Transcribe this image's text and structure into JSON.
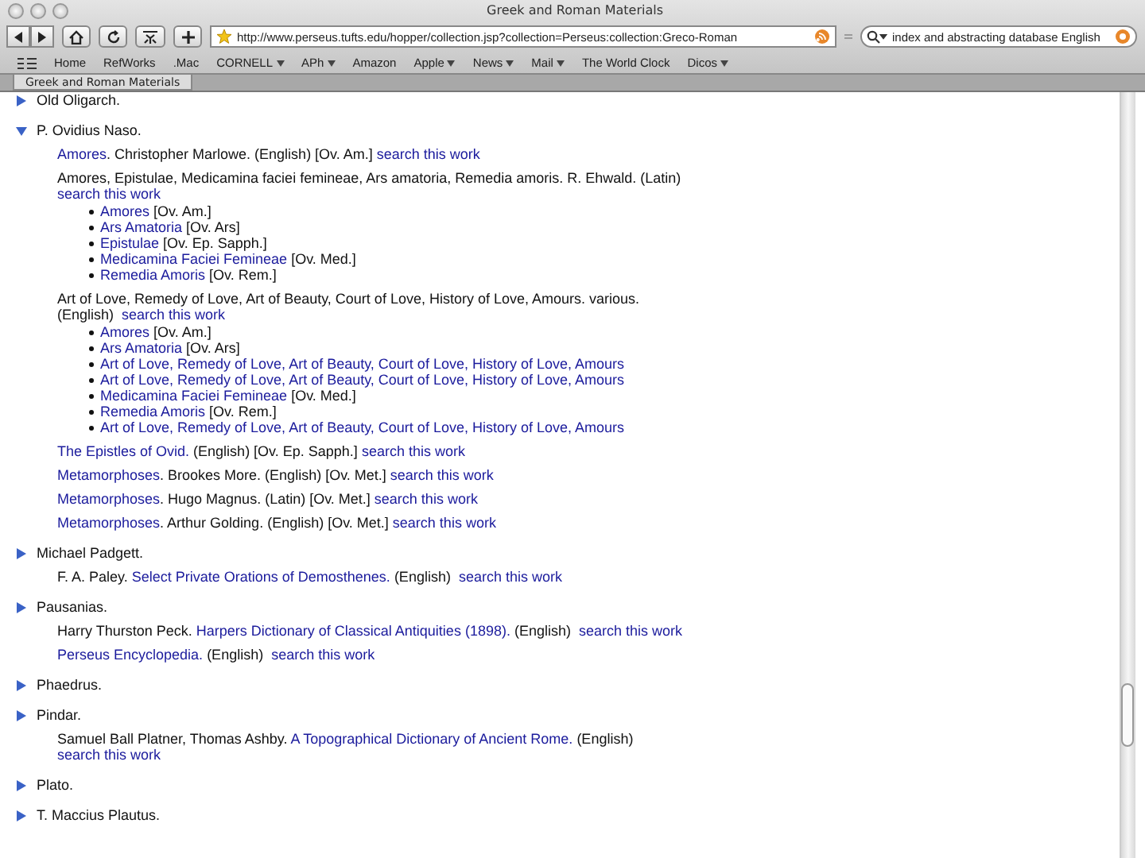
{
  "window": {
    "title": "Greek and Roman Materials"
  },
  "toolbar": {
    "address": "http://www.perseus.tufts.edu/hopper/collection.jsp?collection=Perseus:collection:Greco-Roman",
    "search": "index and abstracting database English"
  },
  "bookmarks": [
    {
      "label": "Home",
      "menu": false
    },
    {
      "label": "RefWorks",
      "menu": false
    },
    {
      "label": ".Mac",
      "menu": false
    },
    {
      "label": "CORNELL",
      "menu": true
    },
    {
      "label": "APh",
      "menu": true
    },
    {
      "label": "Amazon",
      "menu": false
    },
    {
      "label": "Apple",
      "menu": true
    },
    {
      "label": "News",
      "menu": true
    },
    {
      "label": "Mail",
      "menu": true
    },
    {
      "label": "The World Clock",
      "menu": false
    },
    {
      "label": "Dicos",
      "menu": true
    }
  ],
  "tabs": [
    {
      "label": "Greek and Roman Materials",
      "selected": true
    }
  ],
  "authors": [
    {
      "name": "Old Oligarch.",
      "expanded": false
    },
    {
      "name": "P. Ovidius Naso.",
      "expanded": true,
      "works": [
        {
          "segments": [
            {
              "text": "Amores",
              "link": true
            },
            {
              "text": ". Christopher Marlowe. (English) [Ov. Am.] ",
              "link": false
            },
            {
              "text": "search this work",
              "link": true
            }
          ]
        },
        {
          "segments": [
            {
              "text": "Amores, Epistulae, Medicamina faciei femineae, Ars amatoria, Remedia amoris. R. Ehwald. (Latin)  ",
              "link": false
            },
            {
              "text": "search this work",
              "link": true
            }
          ],
          "items": [
            {
              "segments": [
                {
                  "text": "Amores",
                  "link": true
                },
                {
                  "text": " [Ov. Am.]",
                  "link": false
                }
              ]
            },
            {
              "segments": [
                {
                  "text": "Ars Amatoria",
                  "link": true
                },
                {
                  "text": " [Ov. Ars]",
                  "link": false
                }
              ]
            },
            {
              "segments": [
                {
                  "text": "Epistulae",
                  "link": true
                },
                {
                  "text": " [Ov. Ep. Sapph.]",
                  "link": false
                }
              ]
            },
            {
              "segments": [
                {
                  "text": "Medicamina Faciei Femineae",
                  "link": true
                },
                {
                  "text": " [Ov. Med.]",
                  "link": false
                }
              ]
            },
            {
              "segments": [
                {
                  "text": "Remedia Amoris",
                  "link": true
                },
                {
                  "text": " [Ov. Rem.]",
                  "link": false
                }
              ]
            }
          ]
        },
        {
          "segments": [
            {
              "text": "Art of Love, Remedy of Love, Art of Beauty, Court of Love, History of Love, Amours. various. (English)  ",
              "link": false
            },
            {
              "text": "search this work",
              "link": true
            }
          ],
          "items": [
            {
              "segments": [
                {
                  "text": "Amores",
                  "link": true
                },
                {
                  "text": " [Ov. Am.]",
                  "link": false
                }
              ]
            },
            {
              "segments": [
                {
                  "text": "Ars Amatoria",
                  "link": true
                },
                {
                  "text": " [Ov. Ars]",
                  "link": false
                }
              ]
            },
            {
              "segments": [
                {
                  "text": "Art of Love, Remedy of Love, Art of Beauty, Court of Love, History of Love, Amours",
                  "link": true
                }
              ]
            },
            {
              "segments": [
                {
                  "text": "Art of Love, Remedy of Love, Art of Beauty, Court of Love, History of Love, Amours",
                  "link": true
                }
              ]
            },
            {
              "segments": [
                {
                  "text": "Medicamina Faciei Femineae",
                  "link": true
                },
                {
                  "text": " [Ov. Med.]",
                  "link": false
                }
              ]
            },
            {
              "segments": [
                {
                  "text": "Remedia Amoris",
                  "link": true
                },
                {
                  "text": " [Ov. Rem.]",
                  "link": false
                }
              ]
            },
            {
              "segments": [
                {
                  "text": "Art of Love, Remedy of Love, Art of Beauty, Court of Love, History of Love, Amours",
                  "link": true
                }
              ]
            }
          ]
        },
        {
          "segments": [
            {
              "text": "The Epistles of Ovid.",
              "link": true
            },
            {
              "text": " (English) [Ov. Ep. Sapph.] ",
              "link": false
            },
            {
              "text": "search this work",
              "link": true
            }
          ]
        },
        {
          "segments": [
            {
              "text": "Metamorphoses",
              "link": true
            },
            {
              "text": ". Brookes More. (English) [Ov. Met.] ",
              "link": false
            },
            {
              "text": "search this work",
              "link": true
            }
          ]
        },
        {
          "segments": [
            {
              "text": "Metamorphoses",
              "link": true
            },
            {
              "text": ". Hugo Magnus. (Latin) [Ov. Met.] ",
              "link": false
            },
            {
              "text": "search this work",
              "link": true
            }
          ]
        },
        {
          "segments": [
            {
              "text": "Metamorphoses",
              "link": true
            },
            {
              "text": ". Arthur Golding. (English) [Ov. Met.] ",
              "link": false
            },
            {
              "text": "search this work",
              "link": true
            }
          ]
        }
      ]
    },
    {
      "name": "Michael Padgett.",
      "expanded": false,
      "works": [
        {
          "segments": [
            {
              "text": "F. A. Paley. ",
              "link": false
            },
            {
              "text": "Select Private Orations of Demosthenes.",
              "link": true
            },
            {
              "text": " (English)  ",
              "link": false
            },
            {
              "text": "search this work",
              "link": true
            }
          ]
        }
      ]
    },
    {
      "name": "Pausanias.",
      "expanded": false,
      "works": [
        {
          "segments": [
            {
              "text": "Harry Thurston Peck. ",
              "link": false
            },
            {
              "text": "Harpers Dictionary of Classical Antiquities (1898).",
              "link": true
            },
            {
              "text": " (English)  ",
              "link": false
            },
            {
              "text": "search this work",
              "link": true
            }
          ]
        },
        {
          "segments": [
            {
              "text": "Perseus Encyclopedia.",
              "link": true
            },
            {
              "text": " (English)  ",
              "link": false
            },
            {
              "text": "search this work",
              "link": true
            }
          ]
        }
      ]
    },
    {
      "name": "Phaedrus.",
      "expanded": false
    },
    {
      "name": "Pindar.",
      "expanded": false,
      "works": [
        {
          "segments": [
            {
              "text": "Samuel Ball Platner, Thomas Ashby. ",
              "link": false
            },
            {
              "text": "A Topographical Dictionary of Ancient Rome.",
              "link": true
            },
            {
              "text": " (English)  ",
              "link": false
            },
            {
              "text": "search this work",
              "link": true
            }
          ]
        }
      ]
    },
    {
      "name": "Plato.",
      "expanded": false
    },
    {
      "name": "T. Maccius Plautus.",
      "expanded": false
    }
  ]
}
